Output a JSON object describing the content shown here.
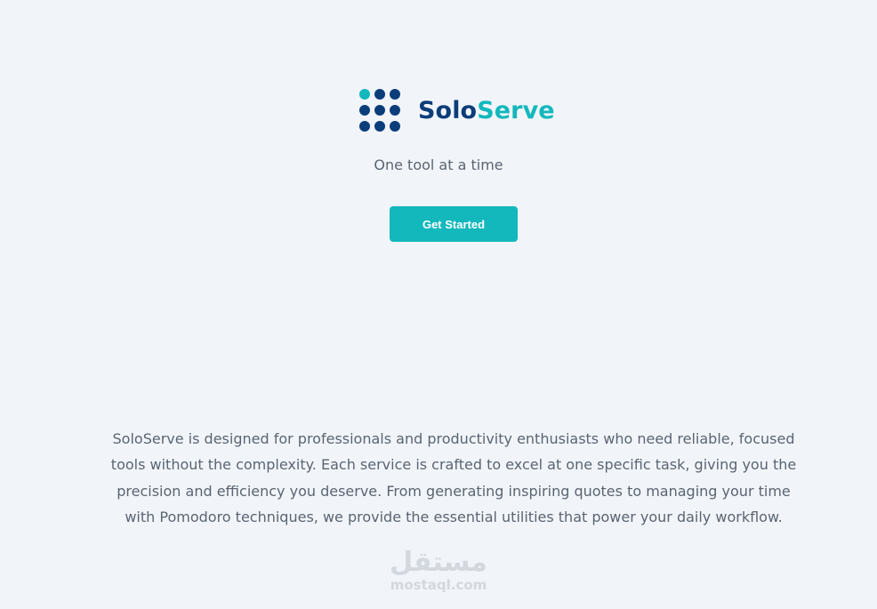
{
  "brand": {
    "name_part_1": "Solo",
    "name_part_2": "Serve",
    "logo_icon": "dot-grid-icon"
  },
  "hero": {
    "tagline": "One tool at a time",
    "cta_label": "Get Started"
  },
  "about": {
    "text": "SoloServe is designed for professionals and productivity enthusiasts who need reliable, focused tools without the complexity. Each service is crafted to excel at one specific task, giving you the precision and efficiency you deserve. From generating inspiring quotes to managing your time with Pomodoro techniques, we provide the essential utilities that power your daily workflow."
  },
  "watermark": {
    "arabic": "مستقل",
    "latin": "mostaql.com"
  },
  "colors": {
    "background": "#f1f5f9",
    "primary_navy": "#0b3d7a",
    "accent_teal": "#13b8bd",
    "body_text": "#5b6472"
  }
}
